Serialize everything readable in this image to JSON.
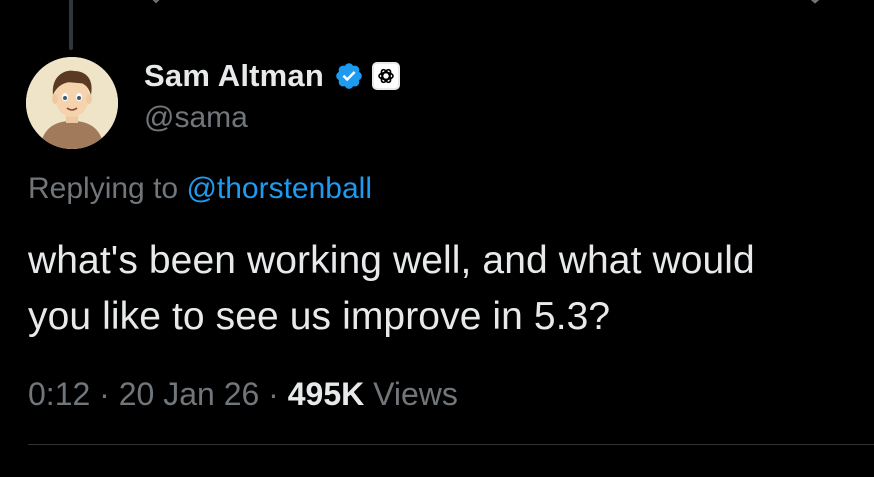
{
  "tweet": {
    "author": {
      "display_name": "Sam Altman",
      "handle": "@sama",
      "verified": true,
      "affiliate_badge": "openai-logo-icon"
    },
    "reply_context": {
      "prefix": "Replying to",
      "mention": "@thorstenball"
    },
    "text_lines": [
      "what's been working well, and what would",
      "you like to see us improve in 5.3?"
    ],
    "meta": {
      "time": "0:12",
      "separator": "·",
      "date": "20 Jan 26",
      "views_count": "495K",
      "views_label": "Views"
    }
  },
  "colors": {
    "background": "#000000",
    "primary_text": "#e7e9ea",
    "secondary_text": "#71767b",
    "link": "#1d9bf0",
    "verified_badge": "#1d9bf0",
    "divider": "#2f3336"
  }
}
